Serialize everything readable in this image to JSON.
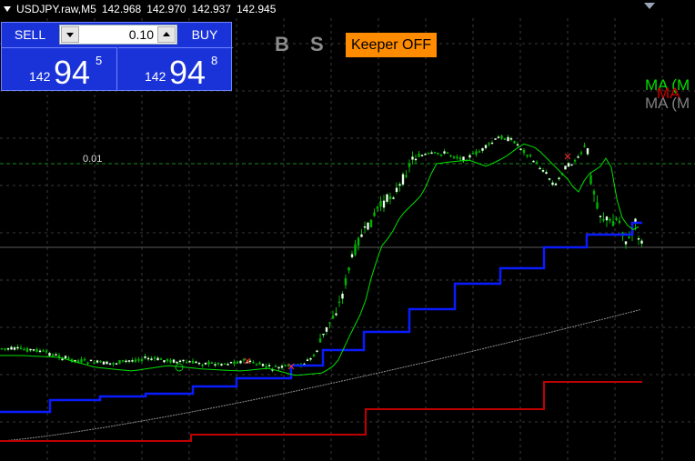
{
  "header": {
    "symbol": "USDJPY.raw,M5",
    "open": "142.968",
    "high": "142.970",
    "low": "142.937",
    "close": "142.945"
  },
  "trade_panel": {
    "sell_label": "SELL",
    "buy_label": "BUY",
    "lot_value": "0.10",
    "sell_price_prefix": "142",
    "sell_price_big": "94",
    "sell_price_sup": "5",
    "buy_price_prefix": "142",
    "buy_price_big": "94",
    "buy_price_sup": "8"
  },
  "toolbar": {
    "b_label": "B",
    "s_label": "S",
    "keeper_label": "Keeper OFF"
  },
  "chart_labels": {
    "lot_label": "0.01",
    "ma1": "MA (M",
    "ma2": "MA",
    "ma3": "MA (M"
  },
  "colors": {
    "background": "#000000",
    "panel_blue": "#1a33d8",
    "keeper_orange": "#ff8c00",
    "candle": "#00c800",
    "ma_fast": "#00e000",
    "ma_step_blue": "#0000ff",
    "ma_step_red": "#c00000",
    "ma_slow_gray": "#808080"
  }
}
